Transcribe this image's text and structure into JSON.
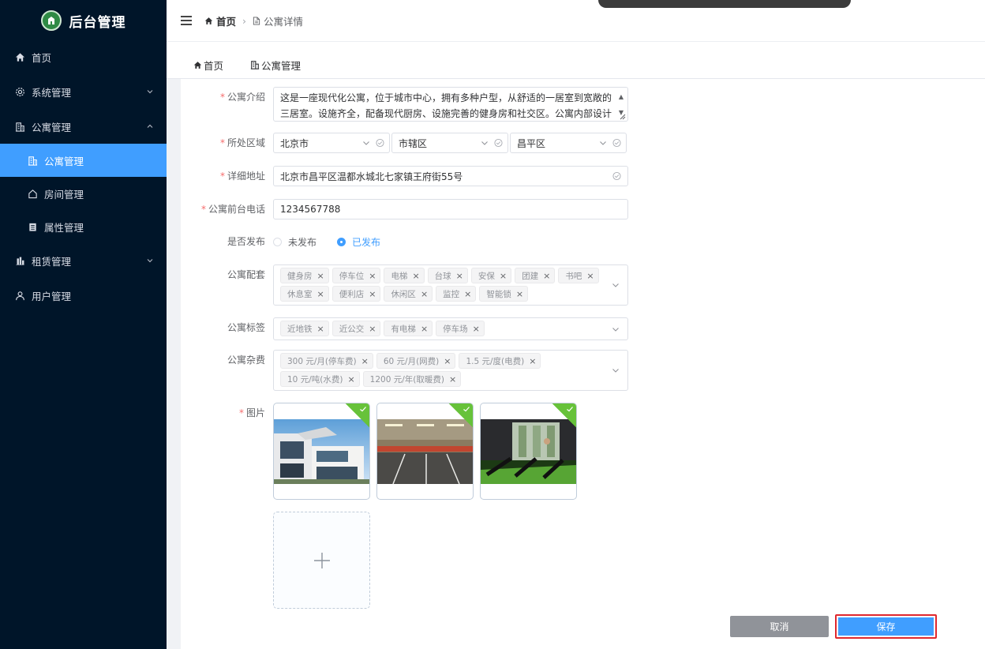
{
  "app": {
    "title": "后台管理"
  },
  "sidebar": {
    "items": [
      {
        "label": "首页",
        "icon": "home-icon"
      },
      {
        "label": "系统管理",
        "icon": "gear-icon"
      },
      {
        "label": "公寓管理",
        "icon": "building-icon"
      },
      {
        "label": "租赁管理",
        "icon": "chart-icon"
      },
      {
        "label": "用户管理",
        "icon": "user-icon"
      }
    ],
    "sub_items": [
      {
        "label": "公寓管理",
        "icon": "building-icon",
        "active": true
      },
      {
        "label": "房间管理",
        "icon": "house-icon"
      },
      {
        "label": "属性管理",
        "icon": "list-icon"
      }
    ]
  },
  "header": {
    "breadcrumb_home": "首页",
    "breadcrumb_current": "公寓详情"
  },
  "tabs": [
    {
      "label": "首页"
    },
    {
      "label": "公寓管理"
    }
  ],
  "form": {
    "intro": {
      "label": "公寓介绍",
      "value": "这是一座现代化公寓，位于城市中心，拥有多种户型，从舒适的一居室到宽敞的三居室。设施齐全，配备现代厨房、设施完善的健身房和社交区。公寓内部设计"
    },
    "region": {
      "label": "所处区域",
      "province": "北京市",
      "city": "市辖区",
      "district": "昌平区"
    },
    "address": {
      "label": "详细地址",
      "value": "北京市昌平区温都水城北七家镇王府街55号"
    },
    "phone": {
      "label": "公寓前台电话",
      "value": "1234567788"
    },
    "publish": {
      "label": "是否发布",
      "options": [
        "未发布",
        "已发布"
      ],
      "selected": "已发布"
    },
    "facilities": {
      "label": "公寓配套",
      "tags": [
        "健身房",
        "停车位",
        "电梯",
        "台球",
        "安保",
        "团建",
        "书吧",
        "休息室",
        "便利店",
        "休闲区",
        "监控",
        "智能锁"
      ]
    },
    "labels": {
      "label": "公寓标签",
      "tags": [
        "近地铁",
        "近公交",
        "有电梯",
        "停车场"
      ]
    },
    "fees": {
      "label": "公寓杂费",
      "tags": [
        "300 元/月(停车费)",
        "60 元/月(网费)",
        "1.5 元/度(电费)",
        "10 元/吨(水费)",
        "1200 元/年(取暖费)"
      ]
    },
    "images": {
      "label": "图片"
    }
  },
  "buttons": {
    "cancel": "取消",
    "save": "保存"
  },
  "colors": {
    "sidebar_bg": "#001529",
    "active": "#409eff",
    "success": "#67c23a",
    "required": "#f56c6c"
  }
}
